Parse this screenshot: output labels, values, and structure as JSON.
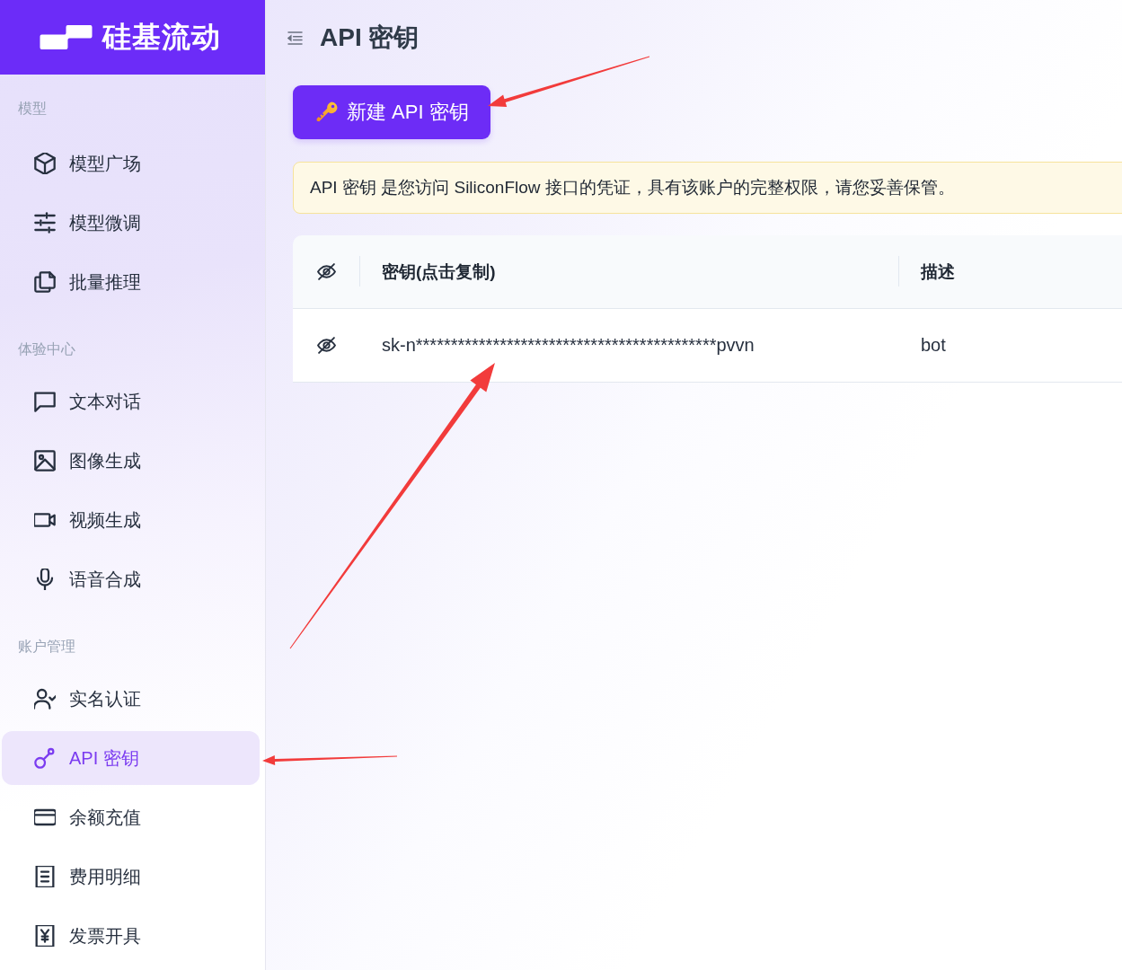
{
  "brand": {
    "name": "硅基流动"
  },
  "sidebar": {
    "sections": [
      {
        "title": "模型",
        "items": [
          {
            "label": "模型广场",
            "selected": false
          },
          {
            "label": "模型微调",
            "selected": false
          },
          {
            "label": "批量推理",
            "selected": false
          }
        ]
      },
      {
        "title": "体验中心",
        "items": [
          {
            "label": "文本对话",
            "selected": false
          },
          {
            "label": "图像生成",
            "selected": false
          },
          {
            "label": "视频生成",
            "selected": false
          },
          {
            "label": "语音合成",
            "selected": false
          }
        ]
      },
      {
        "title": "账户管理",
        "items": [
          {
            "label": "实名认证",
            "selected": false
          },
          {
            "label": "API 密钥",
            "selected": true
          },
          {
            "label": "余额充值",
            "selected": false
          },
          {
            "label": "费用明细",
            "selected": false
          },
          {
            "label": "发票开具",
            "selected": false
          }
        ]
      }
    ]
  },
  "page": {
    "title": "API 密钥"
  },
  "create_button": {
    "label": "新建 API 密钥"
  },
  "notice": {
    "text": "API 密钥 是您访问 SiliconFlow 接口的凭证，具有该账户的完整权限，请您妥善保管。"
  },
  "table": {
    "masked": true,
    "columns": [
      "密钥(点击复制)",
      "描述"
    ],
    "rows": [
      {
        "masked": true,
        "key": "sk-n*******************************************pvvn",
        "description": "bot"
      }
    ]
  },
  "annotations": [
    {
      "kind": "arrow"
    },
    {
      "kind": "arrow"
    },
    {
      "kind": "arrow"
    }
  ]
}
